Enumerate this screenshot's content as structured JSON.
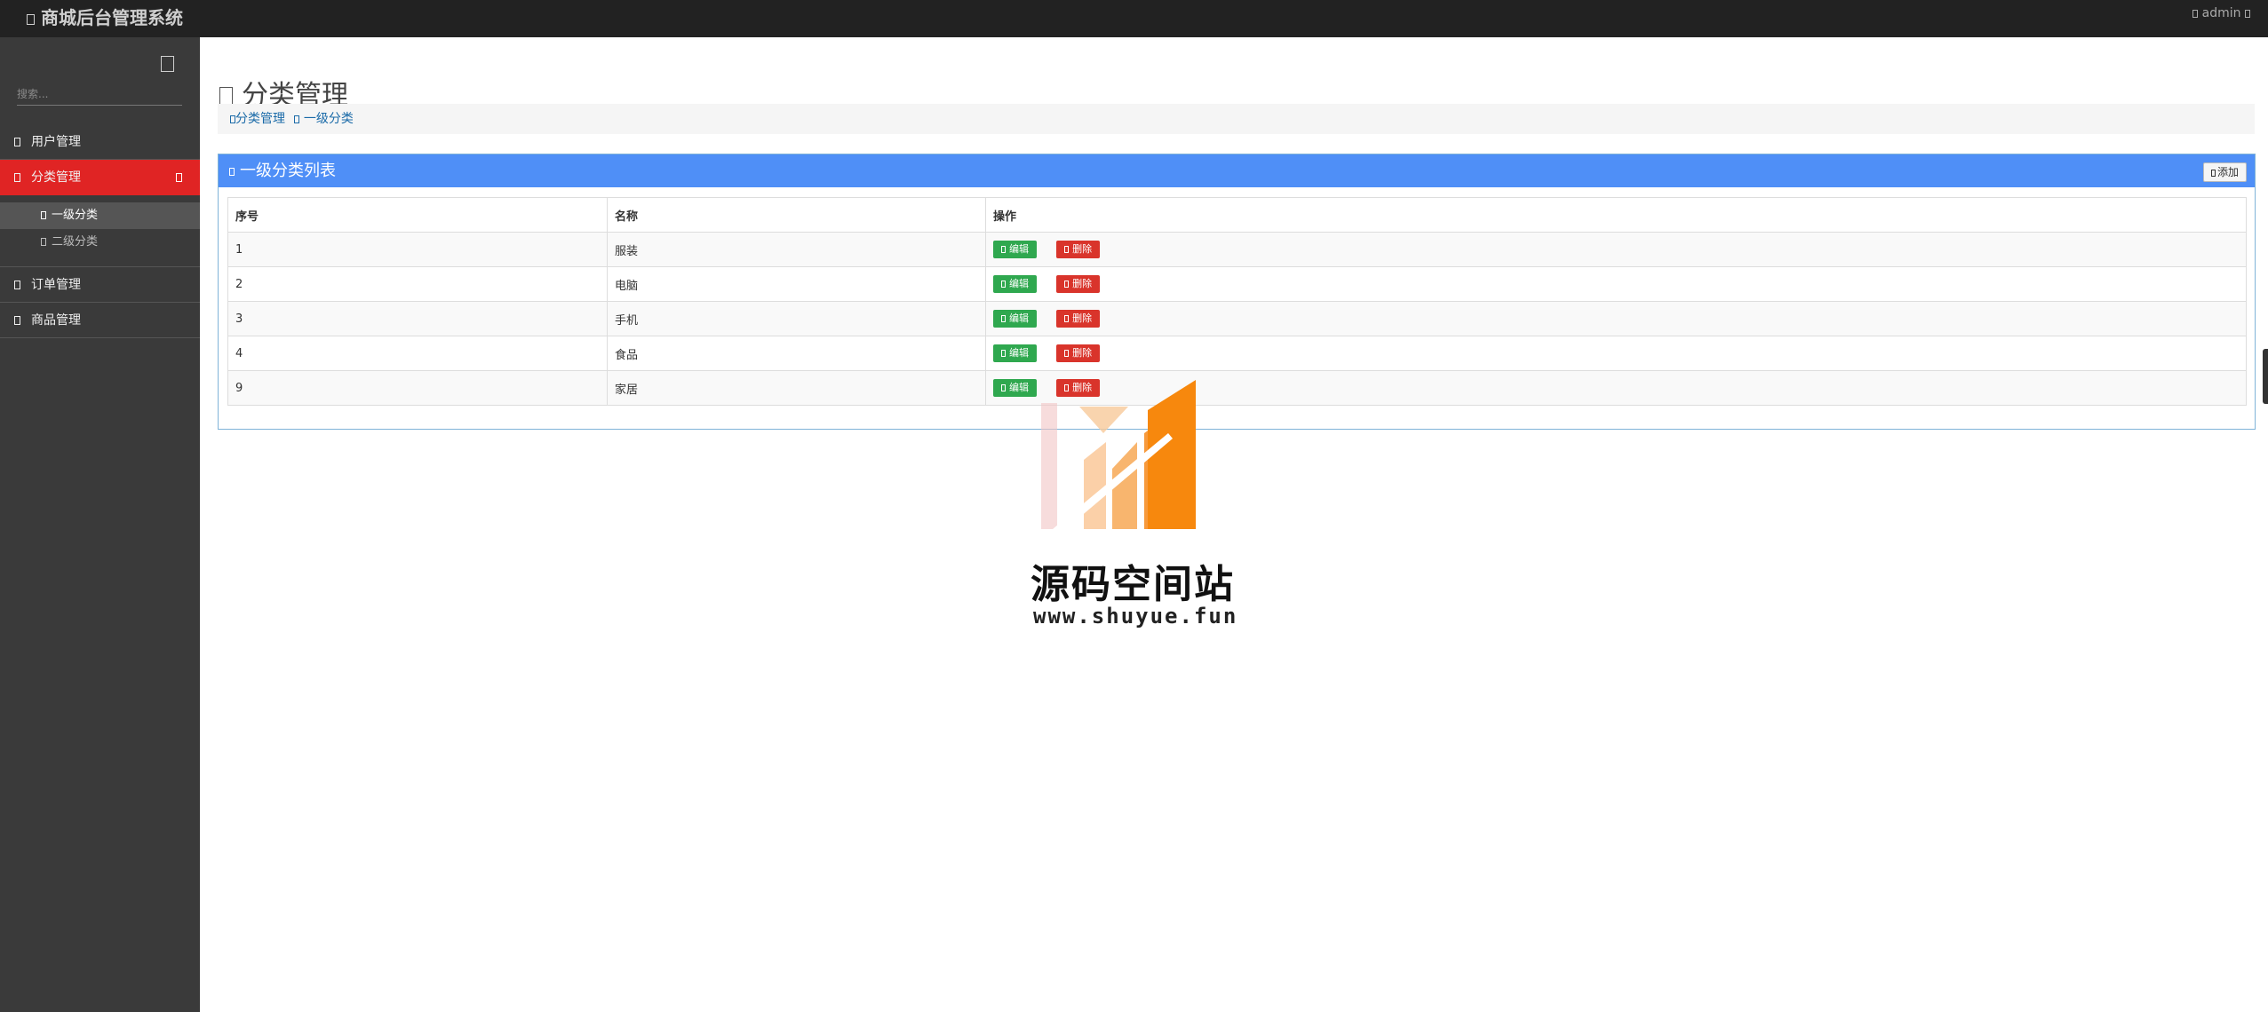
{
  "app": {
    "title": "商城后台管理系统",
    "user": "admin"
  },
  "sidebar": {
    "search_placeholder": "搜索...",
    "items": [
      {
        "label": "用户管理"
      },
      {
        "label": "分类管理",
        "active": true,
        "children": [
          {
            "label": "一级分类",
            "active": true
          },
          {
            "label": "二级分类"
          }
        ]
      },
      {
        "label": "订单管理"
      },
      {
        "label": "商品管理"
      }
    ]
  },
  "main": {
    "title": "分类管理",
    "breadcrumb": {
      "parent": "分类管理",
      "current": "一级分类"
    },
    "panel": {
      "title": "一级分类列表",
      "add_label": "添加",
      "columns": [
        "序号",
        "名称",
        "操作"
      ],
      "edit_label": "编辑",
      "delete_label": "删除",
      "rows": [
        {
          "id": "1",
          "name": "服装"
        },
        {
          "id": "2",
          "name": "电脑"
        },
        {
          "id": "3",
          "name": "手机"
        },
        {
          "id": "4",
          "name": "食品"
        },
        {
          "id": "9",
          "name": "家居"
        }
      ]
    }
  },
  "watermark": {
    "title": "源码空间站",
    "url": "www.shuyue.fun"
  },
  "colors": {
    "topbar": "#222222",
    "sidebar": "#3a3a3a",
    "active": "#e02424",
    "panel_head": "#4f8ff7",
    "edit": "#2fa84f",
    "delete": "#d9342b"
  }
}
